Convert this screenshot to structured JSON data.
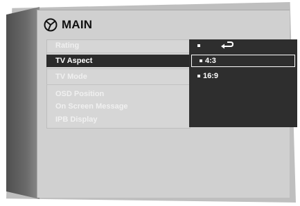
{
  "header": {
    "title": "MAIN",
    "icon": "disc-settings-icon"
  },
  "menu": {
    "items": [
      {
        "label": "Rating"
      },
      {
        "label": "TV Aspect"
      },
      {
        "label": "TV Mode"
      },
      {
        "label": "OSD  Position"
      },
      {
        "label": "On Screen Message"
      },
      {
        "label": "IPB Display"
      }
    ],
    "selected_index": 1
  },
  "options": {
    "return_icon": "return-arrow-icon",
    "items": [
      {
        "label": "4:3"
      },
      {
        "label": "16:9"
      }
    ]
  },
  "colors": {
    "highlight": "#2b2b2b",
    "panel": "#2e2e2e",
    "screen": "#d0d0d0"
  }
}
